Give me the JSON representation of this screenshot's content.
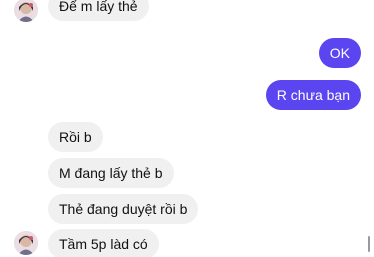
{
  "messages": {
    "m1": "Để m lấy thẻ",
    "m2": "OK",
    "m3": "R chưa bạn",
    "m4": "Rồi b",
    "m5": "M đang lấy thẻ b",
    "m6": "Thẻ đang duyệt rồi b",
    "m7": "Tầm 5p làd có"
  },
  "colors": {
    "outgoing": "#5b45f0",
    "incoming": "#f0f0f0",
    "background": "#ffffff"
  },
  "icons": {
    "contact_avatar": "contact-avatar-icon"
  }
}
